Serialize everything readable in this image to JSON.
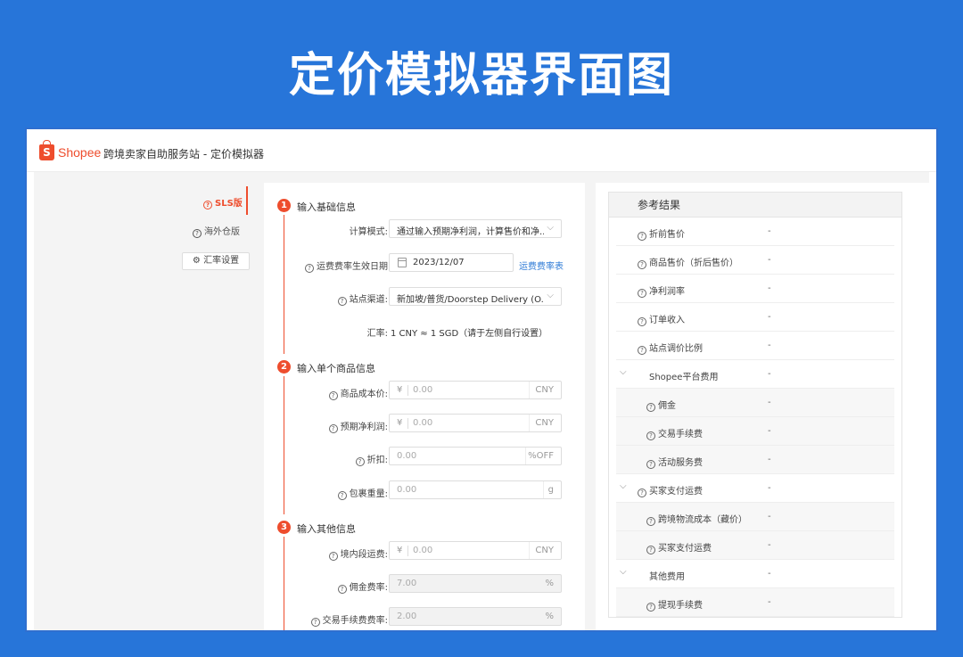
{
  "banner": {
    "title": "定价模拟器界面图"
  },
  "topbar": {
    "logo": "Shopee",
    "logo_glyph": "S",
    "title": "跨境卖家自助服务站 - 定价模拟器"
  },
  "nav": {
    "items": [
      {
        "label": "SLS版",
        "active": true
      },
      {
        "label": "海外仓版",
        "active": false
      }
    ],
    "fx_button": "汇率设置",
    "help_glyph": "?",
    "gear_glyph": "⚙"
  },
  "form": {
    "help_glyph": "?",
    "sections": [
      {
        "num": "1",
        "title": "输入基础信息"
      },
      {
        "num": "2",
        "title": "输入单个商品信息"
      },
      {
        "num": "3",
        "title": "输入其他信息"
      }
    ],
    "basic": {
      "calc_mode_label": "计算模式:",
      "calc_mode_value": "通过输入预期净利润，计算售价和净...",
      "date_label": "运费费率生效日期",
      "date_value": "2023/12/07",
      "date_link": "运费费率表",
      "channel_label": "站点渠道:",
      "channel_value": "新加坡/普货/Doorstep Delivery (O...",
      "fx_label": "汇率:",
      "fx_value": "1 CNY ≈ 1 SGD（请于左侧自行设置）",
      "chevron": "⌵"
    },
    "product": {
      "cost_label": "商品成本价:",
      "cost_prefix": "¥",
      "cost_placeholder": "0.00",
      "cost_unit": "CNY",
      "profit_label": "预期净利润:",
      "profit_prefix": "¥",
      "profit_placeholder": "0.00",
      "profit_unit": "CNY",
      "discount_label": "折扣:",
      "discount_placeholder": "0.00",
      "discount_unit": "%OFF",
      "weight_label": "包裹重量:",
      "weight_placeholder": "0.00",
      "weight_unit": "g"
    },
    "other": {
      "domestic_label": "境内段运费:",
      "domestic_prefix": "¥",
      "domestic_placeholder": "0.00",
      "domestic_unit": "CNY",
      "commission_label": "佣金费率:",
      "commission_value": "7.00",
      "commission_unit": "%",
      "txn_label": "交易手续费费率:",
      "txn_value": "2.00",
      "txn_unit": "%"
    }
  },
  "results": {
    "title": "参考结果",
    "help_glyph": "?",
    "expand_glyph": "⌵",
    "rows": [
      {
        "label": "折前售价",
        "value": "-",
        "help": true,
        "level": 0
      },
      {
        "label": "商品售价（折后售价）",
        "value": "-",
        "help": true,
        "level": 0
      },
      {
        "label": "净利润率",
        "value": "-",
        "help": true,
        "level": 0
      },
      {
        "label": "订单收入",
        "value": "-",
        "help": true,
        "level": 0
      },
      {
        "label": "站点调价比例",
        "value": "-",
        "help": true,
        "level": 0
      },
      {
        "label": "Shopee平台费用",
        "value": "-",
        "help": false,
        "level": 0,
        "expand": true
      },
      {
        "label": "佣金",
        "value": "-",
        "help": true,
        "level": 1
      },
      {
        "label": "交易手续费",
        "value": "-",
        "help": true,
        "level": 1
      },
      {
        "label": "活动服务费",
        "value": "-",
        "help": true,
        "level": 1
      },
      {
        "label": "买家支付运费",
        "value": "-",
        "help": true,
        "level": 0,
        "expand": true
      },
      {
        "label": "跨境物流成本（藏价）",
        "value": "-",
        "help": true,
        "level": 1
      },
      {
        "label": "买家支付运费",
        "value": "-",
        "help": true,
        "level": 1
      },
      {
        "label": "其他费用",
        "value": "-",
        "help": false,
        "level": 0,
        "expand": true
      },
      {
        "label": "提现手续费",
        "value": "-",
        "help": true,
        "level": 1
      }
    ]
  }
}
